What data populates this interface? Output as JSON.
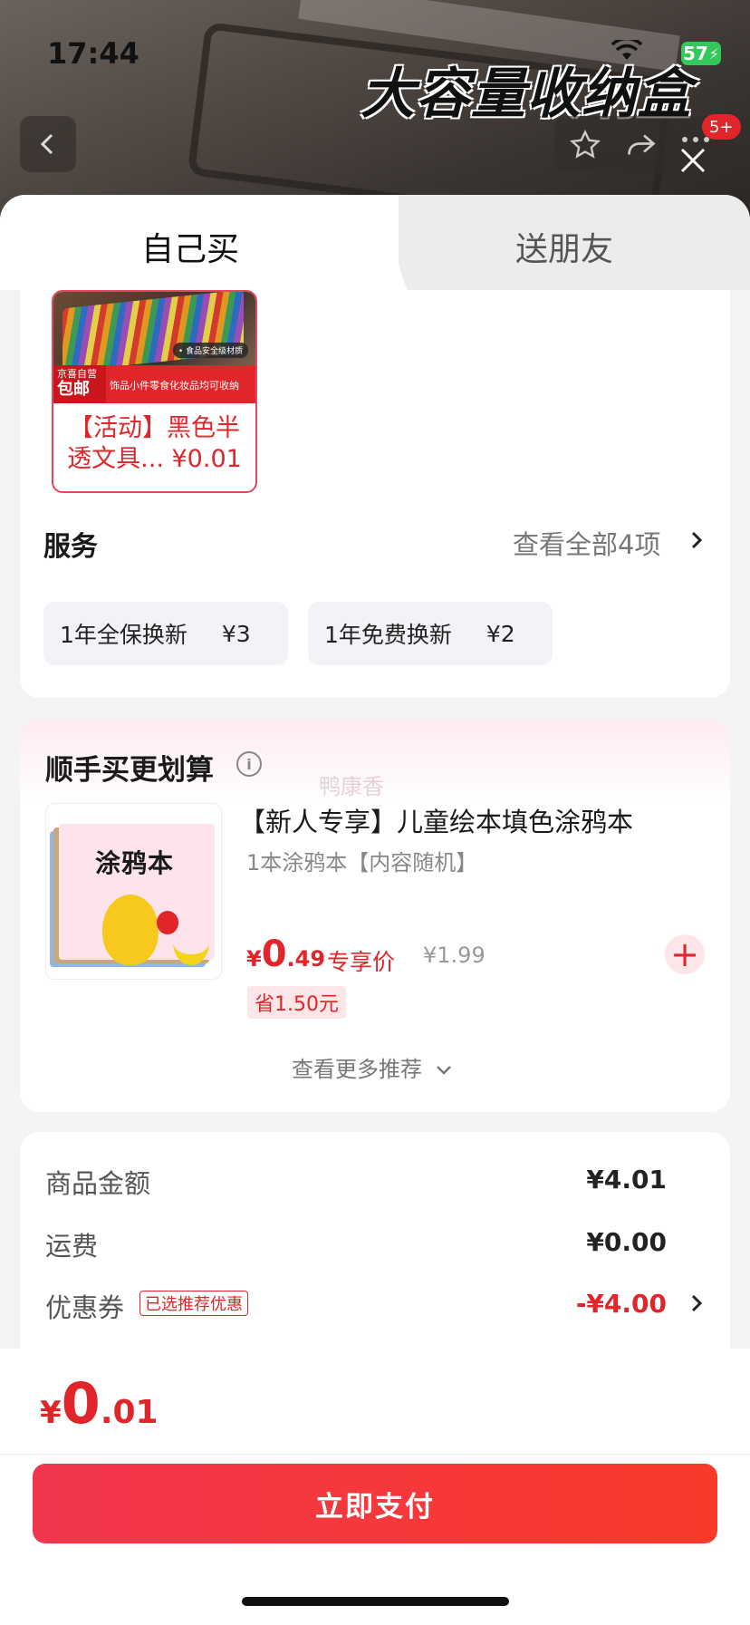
{
  "status_bar": {
    "time": "17:44",
    "battery": "57"
  },
  "header": {
    "banner_title": "大容量收纳盒",
    "cart_badge": "5+"
  },
  "tabs": [
    {
      "label": "自己买",
      "active": true
    },
    {
      "label": "送朋友",
      "active": false
    }
  ],
  "product": {
    "name": "【活动】黑色半透文具... ¥0.01",
    "strip_badge_top": "京喜自营",
    "strip_badge_main": "包邮",
    "strip_text": "饰品小件零食化妆品均可收纳",
    "photo_tag": "• 食品安全级材质"
  },
  "services": {
    "title": "服务",
    "view_all": "查看全部4项",
    "options": [
      {
        "label": "1年全保换新",
        "price": "¥3"
      },
      {
        "label": "1年免费换新",
        "price": "¥2"
      }
    ]
  },
  "recommend": {
    "title": "顺手买更划算",
    "info_icon": "i",
    "watermark": "鸭康香",
    "item": {
      "cover_title": "涂鸦本",
      "name": "【新人专享】儿童绘本填色涂鸦本",
      "spec": "1本涂鸦本【内容随机】",
      "price_currency": "¥",
      "price_int": "0",
      "price_dec": ".49",
      "price_tag": "专享价",
      "original_price": "¥1.99",
      "saving": "省1.50元"
    },
    "see_more": "查看更多推荐"
  },
  "summary": {
    "rows": [
      {
        "label": "商品金额",
        "value": "¥4.01"
      },
      {
        "label": "运费",
        "value": "¥0.00"
      },
      {
        "label": "优惠券",
        "tag": "已选推荐优惠",
        "value": "-¥4.00"
      }
    ]
  },
  "footer": {
    "total_currency": "¥",
    "total_int": "0",
    "total_dec": ".01",
    "pay_label": "立即支付"
  },
  "colors": {
    "accent": "#e0262a",
    "pay_button": "#f2364e",
    "battery": "#34c759"
  }
}
